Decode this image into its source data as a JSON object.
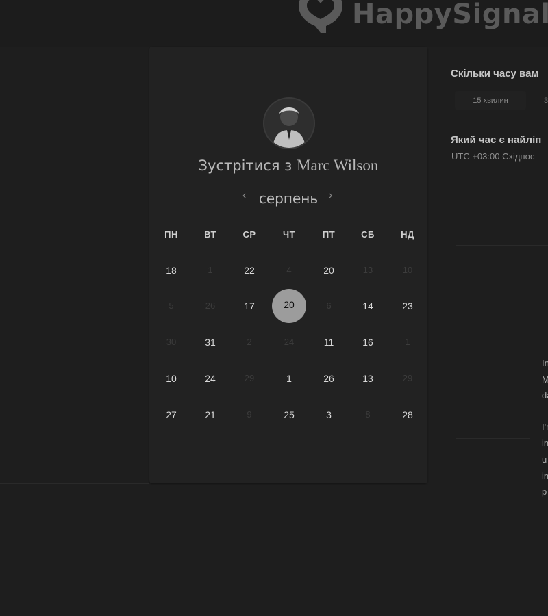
{
  "brand": {
    "name": "HappySignals"
  },
  "scheduler": {
    "title_prefix": "Зустрітися з",
    "host_name": "Marc Wilson",
    "month": "серпень",
    "prev_icon": "‹",
    "next_icon": "›",
    "weekdays": [
      "ПН",
      "ВТ",
      "СР",
      "ЧТ",
      "ПТ",
      "СБ",
      "НД"
    ],
    "weeks": [
      [
        {
          "d": "18",
          "m": false
        },
        {
          "d": "1",
          "m": true
        },
        {
          "d": "22",
          "m": false
        },
        {
          "d": "4",
          "m": true
        },
        {
          "d": "20",
          "m": false
        },
        {
          "d": "13",
          "m": true
        },
        {
          "d": "10",
          "m": true
        }
      ],
      [
        {
          "d": "5",
          "m": true
        },
        {
          "d": "26",
          "m": true
        },
        {
          "d": "17",
          "m": false
        },
        {
          "d": "20",
          "m": false,
          "selected": true
        },
        {
          "d": "6",
          "m": true
        },
        {
          "d": "14",
          "m": false
        },
        {
          "d": "23",
          "m": false
        }
      ],
      [
        {
          "d": "30",
          "m": true
        },
        {
          "d": "31",
          "m": false
        },
        {
          "d": "2",
          "m": true
        },
        {
          "d": "24",
          "m": true
        },
        {
          "d": "11",
          "m": false
        },
        {
          "d": "16",
          "m": false
        },
        {
          "d": "1",
          "m": true
        }
      ],
      [
        {
          "d": "10",
          "m": false
        },
        {
          "d": "24",
          "m": false
        },
        {
          "d": "29",
          "m": true
        },
        {
          "d": "1",
          "m": false
        },
        {
          "d": "26",
          "m": false
        },
        {
          "d": "13",
          "m": false
        },
        {
          "d": "29",
          "m": true
        }
      ],
      [
        {
          "d": "27",
          "m": false
        },
        {
          "d": "21",
          "m": false
        },
        {
          "d": "9",
          "m": true
        },
        {
          "d": "25",
          "m": false
        },
        {
          "d": "3",
          "m": false
        },
        {
          "d": "8",
          "m": true
        },
        {
          "d": "28",
          "m": false
        }
      ]
    ]
  },
  "side": {
    "duration_question": "Скільки часу вам",
    "durations": [
      "15 хвилин",
      "3"
    ],
    "time_question": "Який час є найліп",
    "timezone": "UTC +03:00 Східноє",
    "text_fragments": [
      "In",
      "M",
      "da",
      "I'r",
      "in",
      "u",
      "in",
      "p"
    ]
  },
  "colors": {
    "background": "#1e1e1e",
    "card": "#222222",
    "selected_day": "#9c9c9c"
  }
}
